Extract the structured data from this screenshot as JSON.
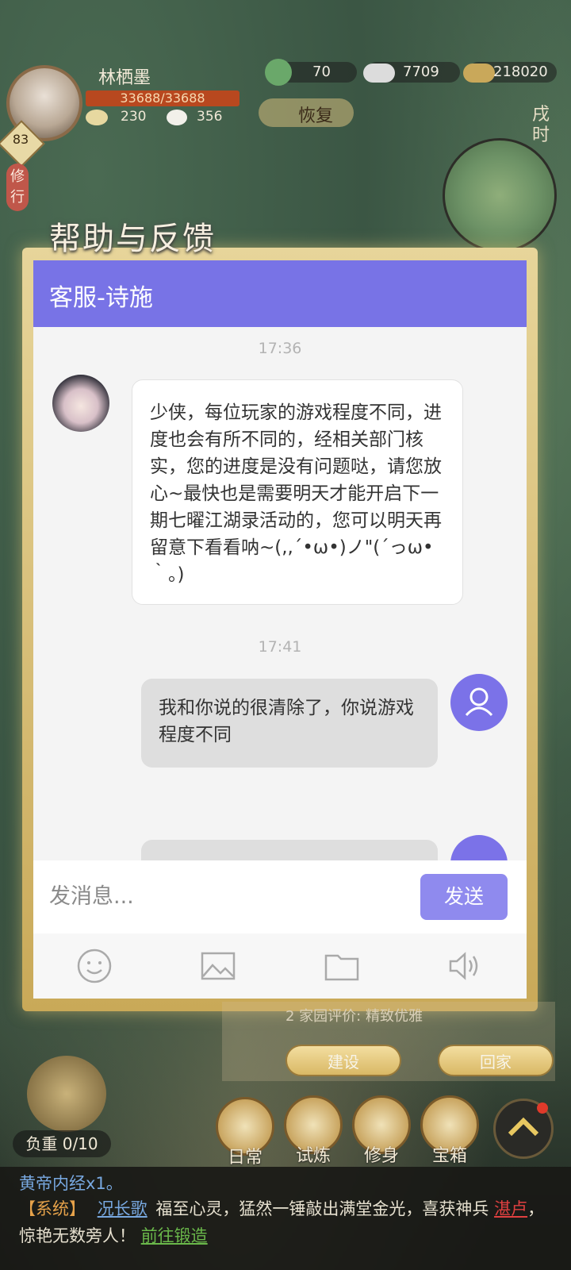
{
  "player": {
    "name": "林栖墨",
    "hp": "33688/33688",
    "level": "83",
    "stat_a": "230",
    "stat_b": "356"
  },
  "resources": {
    "jade": "70",
    "silver": "7709",
    "copper": "218020",
    "recover_label": "恢复"
  },
  "time_label": "戌时",
  "side_tag": "修行",
  "dialog": {
    "window_title": "帮助与反馈",
    "chat_header": "客服-诗施",
    "messages": [
      {
        "time": "17:36",
        "from": "agent",
        "text": "少侠，每位玩家的游戏程度不同，进度也会有所不同的，经相关部门核实，您的进度是没有问题哒，请您放心~最快也是需要明天才能开启下一期七曜江湖录活动的，您可以明天再留意下看看呐~(,,´•ω•)ノ\"(´っω•｀。)"
      },
      {
        "time": "17:41",
        "from": "user",
        "text": "我和你说的很清除了，你说游戏程度不同"
      },
      {
        "time": "",
        "from": "user",
        "text": ""
      }
    ],
    "input_placeholder": "发消息...",
    "send_label": "发送",
    "tools": [
      "emoji-icon",
      "image-icon",
      "folder-icon",
      "speaker-icon"
    ]
  },
  "home": {
    "build_label": "建设",
    "go_home_label": "回家",
    "info_text": "2  家园评价: 精致优雅"
  },
  "load": {
    "label": "负重 0/10"
  },
  "bottom_nav": [
    "日常",
    "试炼",
    "修身",
    "宝箱"
  ],
  "chat_log": {
    "line1_item": "黄帝内经x1。",
    "line2_tag": "【系统】",
    "line2_name": "况长歌",
    "line2_text": "福至心灵，猛然一锤敲出满堂金光，喜获神兵",
    "line2_item": "湛卢",
    "line2_tail": "，惊艳无数旁人！",
    "line2_link": "前往锻造"
  },
  "colors": {
    "header": "#7873e6",
    "send": "#8f8aee",
    "user_avatar": "#7b72e8"
  }
}
